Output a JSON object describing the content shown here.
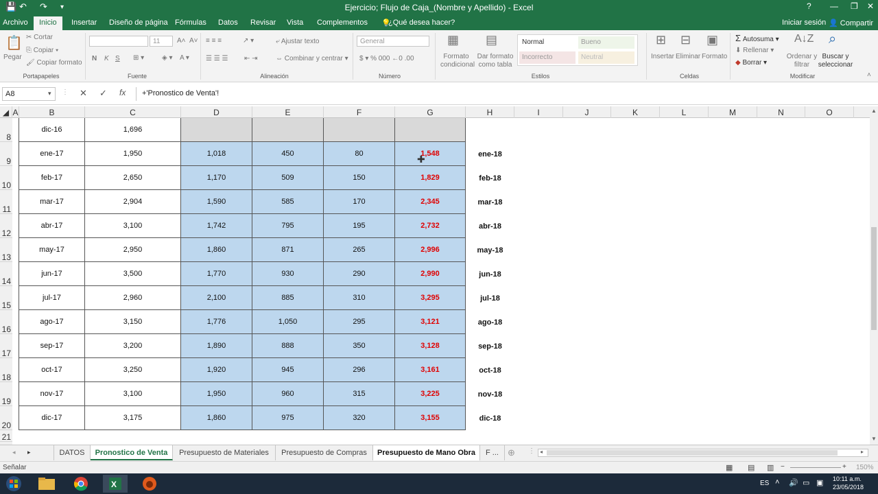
{
  "window": {
    "title": "Ejercicio; Flujo de Caja_(Nombre y Apellido) - Excel",
    "help": "?",
    "min": "—",
    "restore": "❐",
    "close": "✕"
  },
  "quick_access": {
    "save": "💾",
    "undo": "↶",
    "redo": "↷",
    "customize": "▾"
  },
  "menu": {
    "archivo": "Archivo",
    "tabs": [
      "Inicio",
      "Insertar",
      "Diseño de página",
      "Fórmulas",
      "Datos",
      "Revisar",
      "Vista",
      "Complementos"
    ],
    "tell_me": "¿Qué desea hacer?",
    "sign_in": "Iniciar sesión",
    "share": "Compartir"
  },
  "ribbon": {
    "clipboard": {
      "paste": "Pegar",
      "cut": "Cortar",
      "copy": "Copiar",
      "format_painter": "Copiar formato",
      "group": "Portapapeles"
    },
    "font": {
      "name": "",
      "size": "11",
      "bold": "N",
      "italic": "K",
      "underline": "S",
      "group": "Fuente"
    },
    "alignment": {
      "wrap": "Ajustar texto",
      "merge": "Combinar y centrar",
      "group": "Alineación"
    },
    "number": {
      "format": "General",
      "group": "Número"
    },
    "styles": {
      "cond": "Formato condicional",
      "table": "Dar formato como tabla",
      "normal": "Normal",
      "bueno": "Bueno",
      "incorrecto": "Incorrecto",
      "neutral": "Neutral",
      "group": "Estilos"
    },
    "cells": {
      "insert": "Insertar",
      "delete": "Eliminar",
      "format": "Formato",
      "group": "Celdas"
    },
    "editing": {
      "autosum": "Autosuma",
      "fill": "Rellenar",
      "clear": "Borrar",
      "sort": "Ordenar y filtrar",
      "find": "Buscar y seleccionar",
      "group": "Modificar"
    }
  },
  "formula_bar": {
    "name_box": "A8",
    "cancel": "✕",
    "enter": "✓",
    "fx": "fx",
    "formula": "+'Pronostico de Venta'!"
  },
  "columns": [
    "A",
    "B",
    "C",
    "D",
    "E",
    "F",
    "G",
    "H",
    "I",
    "J",
    "K",
    "L",
    "M",
    "N",
    "O"
  ],
  "rows": [
    {
      "n": "8",
      "b": "dic-16",
      "c": "1,696",
      "d": "",
      "e": "",
      "f": "",
      "g": "",
      "h": ""
    },
    {
      "n": "9",
      "b": "ene-17",
      "c": "1,950",
      "d": "1,018",
      "e": "450",
      "f": "80",
      "g": "1,548",
      "h": "ene-18"
    },
    {
      "n": "10",
      "b": "feb-17",
      "c": "2,650",
      "d": "1,170",
      "e": "509",
      "f": "150",
      "g": "1,829",
      "h": "feb-18"
    },
    {
      "n": "11",
      "b": "mar-17",
      "c": "2,904",
      "d": "1,590",
      "e": "585",
      "f": "170",
      "g": "2,345",
      "h": "mar-18"
    },
    {
      "n": "12",
      "b": "abr-17",
      "c": "3,100",
      "d": "1,742",
      "e": "795",
      "f": "195",
      "g": "2,732",
      "h": "abr-18"
    },
    {
      "n": "13",
      "b": "may-17",
      "c": "2,950",
      "d": "1,860",
      "e": "871",
      "f": "265",
      "g": "2,996",
      "h": "may-18"
    },
    {
      "n": "14",
      "b": "jun-17",
      "c": "3,500",
      "d": "1,770",
      "e": "930",
      "f": "290",
      "g": "2,990",
      "h": "jun-18"
    },
    {
      "n": "15",
      "b": "jul-17",
      "c": "2,960",
      "d": "2,100",
      "e": "885",
      "f": "310",
      "g": "3,295",
      "h": "jul-18"
    },
    {
      "n": "16",
      "b": "ago-17",
      "c": "3,150",
      "d": "1,776",
      "e": "1,050",
      "f": "295",
      "g": "3,121",
      "h": "ago-18"
    },
    {
      "n": "17",
      "b": "sep-17",
      "c": "3,200",
      "d": "1,890",
      "e": "888",
      "f": "350",
      "g": "3,128",
      "h": "sep-18"
    },
    {
      "n": "18",
      "b": "oct-17",
      "c": "3,250",
      "d": "1,920",
      "e": "945",
      "f": "296",
      "g": "3,161",
      "h": "oct-18"
    },
    {
      "n": "19",
      "b": "nov-17",
      "c": "3,100",
      "d": "1,950",
      "e": "960",
      "f": "315",
      "g": "3,225",
      "h": "nov-18"
    },
    {
      "n": "20",
      "b": "dic-17",
      "c": "3,175",
      "d": "1,860",
      "e": "975",
      "f": "320",
      "g": "3,155",
      "h": "dic-18"
    },
    {
      "n": "21",
      "b": "",
      "c": "",
      "d": "",
      "e": "",
      "f": "",
      "g": "",
      "h": ""
    }
  ],
  "sheet_tabs": [
    "DATOS",
    "Pronostico de Venta",
    "Presupuesto de Materiales",
    "Presupuesto de Compras",
    "Presupuesto de Mano Obra",
    "F ..."
  ],
  "active_tab": "Pronostico de Venta",
  "status": {
    "mode": "Señalar",
    "zoom": "150%"
  },
  "taskbar": {
    "lang": "ES",
    "time": "10:11 a.m.",
    "date": "23/05/2018"
  },
  "colors": {
    "excel_green": "#217346",
    "blue_fill": "#bdd7ee",
    "red_text": "#e00000"
  }
}
